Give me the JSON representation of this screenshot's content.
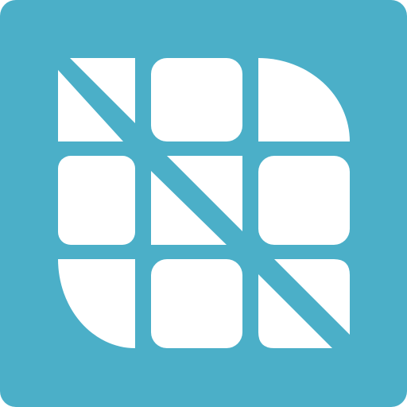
{
  "icon": {
    "name": "grid-tiles-app-icon",
    "background_color": "#4BAFC8",
    "tile_color": "#FFFFFF",
    "tiles": [
      {
        "name": "tile-top-left",
        "shape": "square-with-diagonal"
      },
      {
        "name": "tile-top-center",
        "shape": "square"
      },
      {
        "name": "tile-top-right",
        "shape": "quarter-circle"
      },
      {
        "name": "tile-middle-left",
        "shape": "square"
      },
      {
        "name": "tile-middle-center",
        "shape": "square-with-diagonal"
      },
      {
        "name": "tile-middle-right",
        "shape": "square"
      },
      {
        "name": "tile-bottom-left",
        "shape": "quarter-circle"
      },
      {
        "name": "tile-bottom-center",
        "shape": "square"
      },
      {
        "name": "tile-bottom-right",
        "shape": "square-with-diagonal"
      }
    ]
  }
}
